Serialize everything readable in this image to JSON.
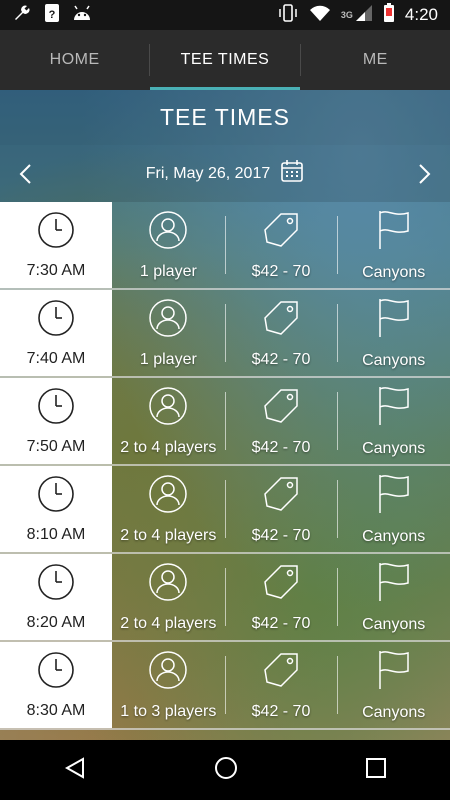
{
  "status": {
    "time": "4:20",
    "network": "3G"
  },
  "tabs": [
    {
      "label": "HOME"
    },
    {
      "label": "TEE TIMES"
    },
    {
      "label": "ME"
    }
  ],
  "page_title": "TEE TIMES",
  "date": "Fri, May 26, 2017",
  "rows": [
    {
      "time": "7:30 AM",
      "players": "1 player",
      "price": "$42 - 70",
      "course": "Canyons"
    },
    {
      "time": "7:40 AM",
      "players": "1 player",
      "price": "$42 - 70",
      "course": "Canyons"
    },
    {
      "time": "7:50 AM",
      "players": "2 to 4 players",
      "price": "$42 - 70",
      "course": "Canyons"
    },
    {
      "time": "8:10 AM",
      "players": "2 to 4 players",
      "price": "$42 - 70",
      "course": "Canyons"
    },
    {
      "time": "8:20 AM",
      "players": "2 to 4 players",
      "price": "$42 - 70",
      "course": "Canyons"
    },
    {
      "time": "8:30 AM",
      "players": "1 to 3 players",
      "price": "$42 - 70",
      "course": "Canyons"
    }
  ],
  "colors": {
    "accent": "#4ab0b5",
    "tabbar": "#2b2b2b",
    "statusbar": "#151515"
  }
}
